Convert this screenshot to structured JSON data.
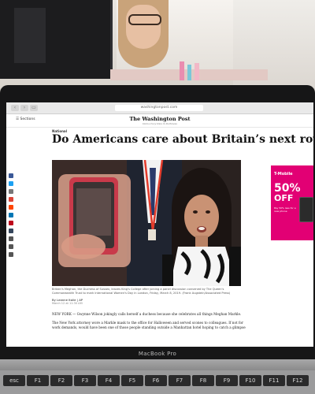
{
  "browser": {
    "url": "washingtonpost.com"
  },
  "site": {
    "sections_label": "Sections",
    "masthead": "The Washington Post",
    "tagline": "Democracy Dies in Darkness"
  },
  "article": {
    "kicker": "National",
    "headline": "Do Americans care about Britain’s next royal birth?",
    "caption": "Britain's Meghan, the Duchess of Sussex, leaves King's College after joining a panel discussion convened by The Queen's Commonwealth Trust to mark International Women's Day in London, Friday, March 8, 2019. (Frank Augstein/Associated Press)",
    "byline": "By Leanne Italie | AP",
    "date": "March 12 at 11:30 AM",
    "paragraph1": "NEW YORK — Gwynne Wilson jokingly calls herself a duchess because she celebrates all things Meghan Markle.",
    "paragraph2": "The New York attorney wore a Markle mask to the office for Halloween and served scones to colleagues. If not for work demands, would have been one of those people standing outside a Manhattan hotel hoping to catch a glimpse"
  },
  "ad": {
    "brand": "T-Mobile",
    "big": "50%",
    "off": "OFF",
    "small": "Pay 50% less for a new phone"
  },
  "laptop": {
    "brand": "MacBook Pro"
  },
  "keyboard": {
    "keys": [
      "esc",
      "F1",
      "F2",
      "F3",
      "F4",
      "F5",
      "F6",
      "F7",
      "F8",
      "F9",
      "F10",
      "F11",
      "F12"
    ]
  },
  "colors": {
    "ad_magenta": "#e20074",
    "bezel": "#161617"
  }
}
